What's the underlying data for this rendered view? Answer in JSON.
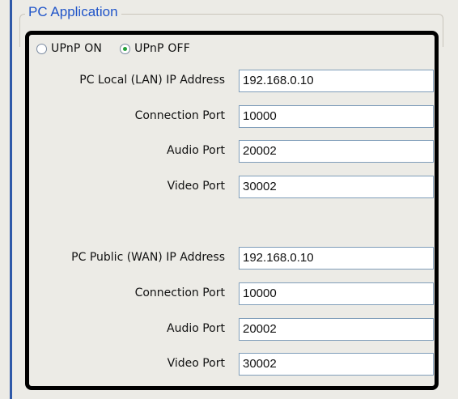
{
  "group": {
    "title": "PC Application"
  },
  "upnp": {
    "on_label": "UPnP ON",
    "off_label": "UPnP OFF",
    "selected": "off"
  },
  "lan": {
    "ip_label": "PC Local (LAN) IP Address",
    "ip_value": "192.168.0.10",
    "connection_label": "Connection Port",
    "connection_value": "10000",
    "audio_label": "Audio Port",
    "audio_value": "20002",
    "video_label": "Video Port",
    "video_value": "30002"
  },
  "wan": {
    "ip_label": "PC Public (WAN) IP Address",
    "ip_value": "192.168.0.10",
    "connection_label": "Connection Port",
    "connection_value": "10000",
    "audio_label": "Audio Port",
    "audio_value": "20002",
    "video_label": "Video Port",
    "video_value": "30002"
  },
  "colors": {
    "title": "#1f54c9",
    "radio_selected": "#23a03a",
    "input_border": "#7f9db9"
  }
}
